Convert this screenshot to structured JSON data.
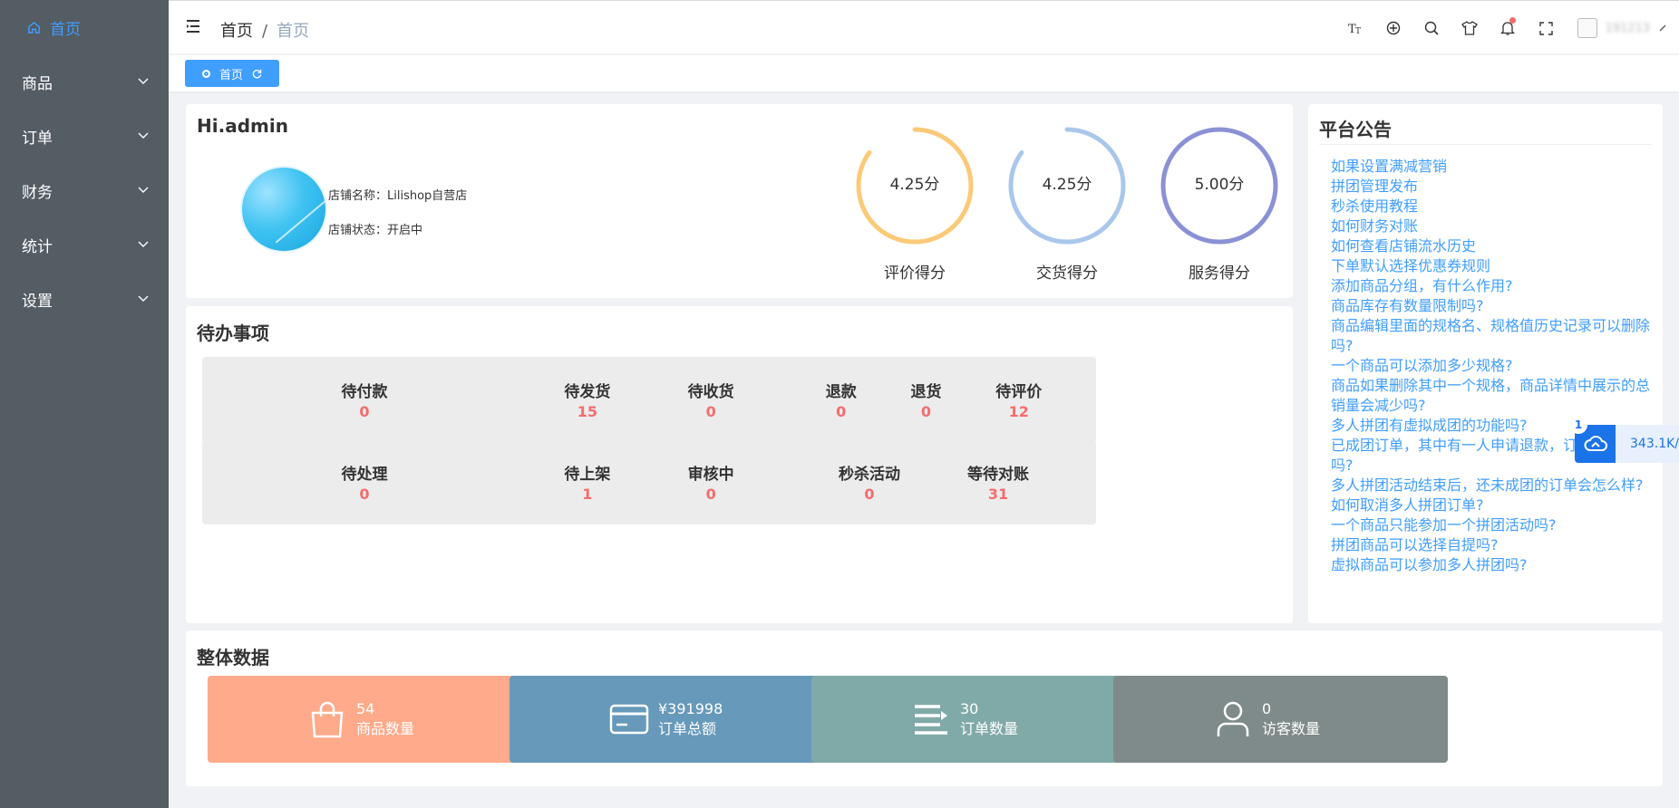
{
  "sidebar": {
    "home": "首页",
    "items": [
      {
        "label": "商品"
      },
      {
        "label": "订单"
      },
      {
        "label": "财务"
      },
      {
        "label": "统计"
      },
      {
        "label": "设置"
      }
    ]
  },
  "header": {
    "breadcrumb": [
      "首页",
      "首页"
    ],
    "icons": [
      "font-size-icon",
      "crosshair-icon",
      "search-icon",
      "shirt-icon",
      "bell-icon",
      "fullscreen-icon"
    ],
    "username": "191213"
  },
  "tags": {
    "home": "首页"
  },
  "welcome": {
    "greeting": "Hi.admin",
    "shop_name": "店铺名称：Lilishop自营店",
    "shop_status": "店铺状态：开启中",
    "scores": [
      {
        "value": "4.25分",
        "label": "评价得分",
        "color": "#fcc978",
        "fraction": 0.85
      },
      {
        "value": "4.25分",
        "label": "交货得分",
        "color": "#a9c7ec",
        "fraction": 0.85
      },
      {
        "value": "5.00分",
        "label": "服务得分",
        "color": "#8a91d4",
        "fraction": 1.0
      }
    ]
  },
  "todo": {
    "title": "待办事项",
    "boxes": [
      [
        {
          "label": "待付款",
          "value": "0"
        }
      ],
      [
        {
          "label": "待发货",
          "value": "15"
        },
        {
          "label": "待收货",
          "value": "0"
        }
      ],
      [
        {
          "label": "退款",
          "value": "0"
        },
        {
          "label": "退货",
          "value": "0"
        },
        {
          "label": "待评价",
          "value": "12"
        }
      ],
      [
        {
          "label": "待处理",
          "value": "0"
        }
      ],
      [
        {
          "label": "待上架",
          "value": "1"
        },
        {
          "label": "审核中",
          "value": "0"
        }
      ],
      [
        {
          "label": "秒杀活动",
          "value": "0"
        },
        {
          "label": "等待对账",
          "value": "31"
        }
      ]
    ]
  },
  "notice": {
    "title": "平台公告",
    "items": [
      "如果设置满减营销",
      "拼团管理发布",
      "秒杀使用教程",
      "如何财务对账",
      "如何查看店铺流水历史",
      "下单默认选择优惠券规则",
      "添加商品分组，有什么作用?",
      "商品库存有数量限制吗?",
      "商品编辑里面的规格名、规格值历史记录可以删除吗?",
      "一个商品可以添加多少规格?",
      "商品如果删除其中一个规格，商品详情中展示的总销量会减少吗?",
      "多人拼团有虚拟成团的功能吗?",
      "已成团订单，其中有一人申请退款，订单有影响吗?",
      "多人拼团活动结束后，还未成团的订单会怎么样?",
      "如何取消多人拼团订单?",
      "一个商品只能参加一个拼团活动吗?",
      "拼团商品可以选择自提吗?",
      "虚拟商品可以参加多人拼团吗?"
    ]
  },
  "overall": {
    "title": "整体数据",
    "stats": [
      {
        "value": "54",
        "label": "商品数量",
        "color": "#ffaa8a",
        "icon": "shopping-bag-icon"
      },
      {
        "value": "¥391998",
        "label": "订单总额",
        "color": "#6699ba",
        "icon": "credit-card-icon"
      },
      {
        "value": "30",
        "label": "订单数量",
        "color": "#80aaa8",
        "icon": "list-icon"
      },
      {
        "value": "0",
        "label": "访客数量",
        "color": "#7f8b8a",
        "icon": "user-icon"
      }
    ]
  },
  "float_widget": {
    "badge": "1",
    "text": "343.1K/"
  }
}
